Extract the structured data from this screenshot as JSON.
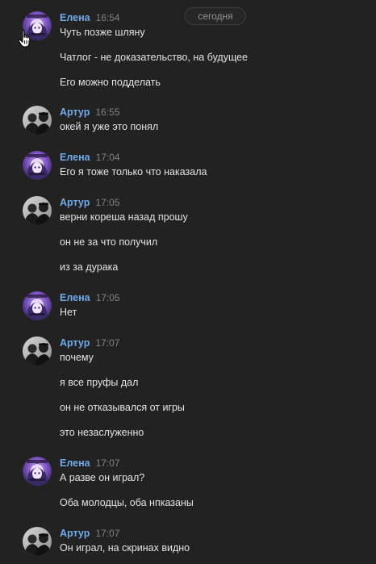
{
  "date_divider": "сегодня",
  "colors": {
    "background": "#222222",
    "author_name": "#71aaeb",
    "timestamp": "#828282",
    "message_text": "#e1e3e6"
  },
  "icons": {
    "cursor": "hand-pointer-icon",
    "avatar_elena": "anime-avatar",
    "avatar_artur": "photo-avatar"
  },
  "groups": [
    {
      "author": "Елена",
      "time": "16:54",
      "messages": [
        "Чуть позже шляну",
        "Чатлог - не доказательство, на будущее",
        "Его можно подделать"
      ]
    },
    {
      "author": "Артур",
      "time": "16:55",
      "messages": [
        "окей я уже это понял"
      ]
    },
    {
      "author": "Елена",
      "time": "17:04",
      "messages": [
        "Его я тоже только что наказала"
      ]
    },
    {
      "author": "Артур",
      "time": "17:05",
      "messages": [
        "верни кореша назад прошу",
        "он не за что получил",
        "из за дурака"
      ]
    },
    {
      "author": "Елена",
      "time": "17:05",
      "messages": [
        "Нет"
      ]
    },
    {
      "author": "Артур",
      "time": "17:07",
      "messages": [
        "почему",
        "я все пруфы дал",
        "он не отказывался от игры",
        "это незаслуженно"
      ]
    },
    {
      "author": "Елена",
      "time": "17:07",
      "messages": [
        "А разве он играл?",
        "Оба молодцы, оба нпказаны"
      ]
    },
    {
      "author": "Артур",
      "time": "17:07",
      "messages": [
        "Он играл, на скринах видно"
      ]
    }
  ]
}
